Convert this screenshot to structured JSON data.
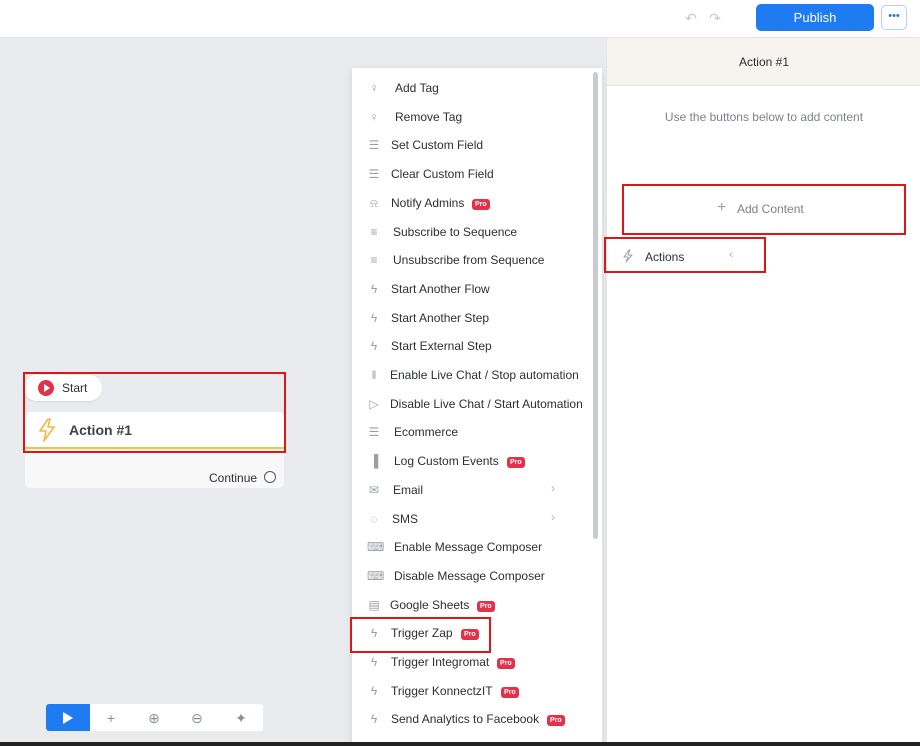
{
  "topbar": {
    "publish_label": "Publish",
    "more_label": "•••"
  },
  "canvas": {
    "start_label": "Start",
    "action_title": "Action #1",
    "continue_label": "Continue"
  },
  "menu": {
    "items": [
      {
        "label": "Add Tag",
        "icon": "tag-user-icon",
        "pro": false,
        "chevron": false
      },
      {
        "label": "Remove Tag",
        "icon": "tag-user-icon",
        "pro": false,
        "chevron": false
      },
      {
        "label": "Set Custom Field",
        "icon": "database-icon",
        "pro": false,
        "chevron": false
      },
      {
        "label": "Clear Custom Field",
        "icon": "database-icon",
        "pro": false,
        "chevron": false
      },
      {
        "label": "Notify Admins",
        "icon": "bell-icon",
        "pro": true,
        "chevron": false
      },
      {
        "label": "Subscribe to Sequence",
        "icon": "sequence-icon",
        "pro": false,
        "chevron": false
      },
      {
        "label": "Unsubscribe from Sequence",
        "icon": "sequence-icon",
        "pro": false,
        "chevron": false
      },
      {
        "label": "Start Another Flow",
        "icon": "bolt-icon",
        "pro": false,
        "chevron": false
      },
      {
        "label": "Start Another Step",
        "icon": "bolt-icon",
        "pro": false,
        "chevron": false
      },
      {
        "label": "Start External Step",
        "icon": "bolt-icon",
        "pro": false,
        "chevron": false
      },
      {
        "label": "Enable Live Chat / Stop automation",
        "icon": "pause-icon",
        "pro": false,
        "chevron": false
      },
      {
        "label": "Disable Live Chat / Start Automation",
        "icon": "play-outline-icon",
        "pro": false,
        "chevron": false
      },
      {
        "label": "Ecommerce",
        "icon": "cart-icon",
        "pro": false,
        "chevron": false
      },
      {
        "label": "Log Custom Events",
        "icon": "bar-chart-icon",
        "pro": true,
        "chevron": false
      },
      {
        "label": "Email",
        "icon": "envelope-icon",
        "pro": false,
        "chevron": true
      },
      {
        "label": "SMS",
        "icon": "chat-bubble-icon",
        "pro": false,
        "chevron": true
      },
      {
        "label": "Enable Message Composer",
        "icon": "keyboard-icon",
        "pro": false,
        "chevron": false
      },
      {
        "label": "Disable Message Composer",
        "icon": "keyboard-icon",
        "pro": false,
        "chevron": false
      },
      {
        "label": "Google Sheets",
        "icon": "sheet-icon",
        "pro": true,
        "chevron": false
      },
      {
        "label": "Trigger Zap",
        "icon": "bolt-icon",
        "pro": true,
        "chevron": false
      },
      {
        "label": "Trigger Integromat",
        "icon": "bolt-icon",
        "pro": true,
        "chevron": false
      },
      {
        "label": "Trigger KonnectzIT",
        "icon": "bolt-icon",
        "pro": true,
        "chevron": false
      },
      {
        "label": "Send Analytics to Facebook",
        "icon": "bolt-icon",
        "pro": true,
        "chevron": false
      }
    ],
    "pro_label": "Pro"
  },
  "panel": {
    "title": "Action #1",
    "hint": "Use the buttons below to add content",
    "add_content_label": "Add Content",
    "actions_label": "Actions"
  },
  "colors": {
    "accent": "#1e7bf2",
    "pro_badge": "#e2324a",
    "highlight": "#e01616",
    "action_underline": "#f4c24a"
  }
}
